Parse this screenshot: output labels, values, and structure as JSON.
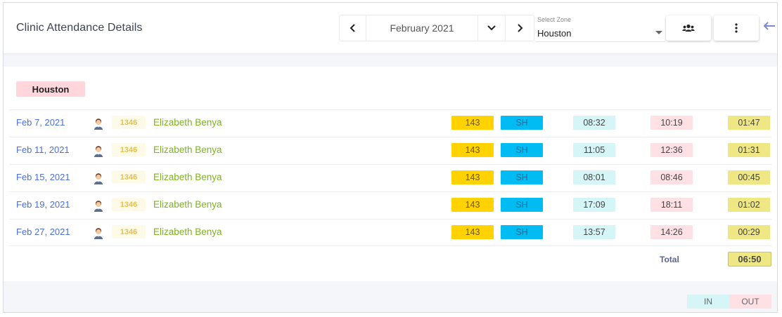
{
  "header": {
    "title": "Clinic Attendance Details",
    "month_nav": {
      "prev_icon": "chevron-left-icon",
      "month": "February 2021",
      "dropdown_icon": "chevron-down-icon",
      "next_icon": "chevron-right-icon"
    },
    "zone_select": {
      "label": "Select Zone",
      "value": "Houston"
    },
    "users_icon": "users-icon",
    "more_icon": "more-vertical-icon",
    "back_icon": "arrow-left-icon"
  },
  "zone": {
    "name": "Houston",
    "badge_color": "#ffd6dc"
  },
  "records": [
    {
      "date": "Feb 7, 2021",
      "emp_id": "1346",
      "name": "Elizabeth Benya",
      "code": "143",
      "shift": "SH",
      "time_in": "08:32",
      "time_out": "10:19",
      "duration": "01:47"
    },
    {
      "date": "Feb 11, 2021",
      "emp_id": "1346",
      "name": "Elizabeth Benya",
      "code": "143",
      "shift": "SH",
      "time_in": "11:05",
      "time_out": "12:36",
      "duration": "01:31"
    },
    {
      "date": "Feb 15, 2021",
      "emp_id": "1346",
      "name": "Elizabeth Benya",
      "code": "143",
      "shift": "SH",
      "time_in": "08:01",
      "time_out": "08:46",
      "duration": "00:45"
    },
    {
      "date": "Feb 19, 2021",
      "emp_id": "1346",
      "name": "Elizabeth Benya",
      "code": "143",
      "shift": "SH",
      "time_in": "17:09",
      "time_out": "18:11",
      "duration": "01:02"
    },
    {
      "date": "Feb 27, 2021",
      "emp_id": "1346",
      "name": "Elizabeth Benya",
      "code": "143",
      "shift": "SH",
      "time_in": "13:57",
      "time_out": "14:26",
      "duration": "00:29"
    }
  ],
  "total": {
    "label": "Total",
    "value": "06:50"
  },
  "legend": {
    "in": "IN",
    "out": "OUT"
  },
  "colors": {
    "date": "#4a6fd8",
    "name": "#7cb518",
    "code": "#ffd200",
    "shift": "#00bcf2",
    "in": "#d5f5f7",
    "out": "#ffe1e5",
    "duration": "#eee784"
  }
}
